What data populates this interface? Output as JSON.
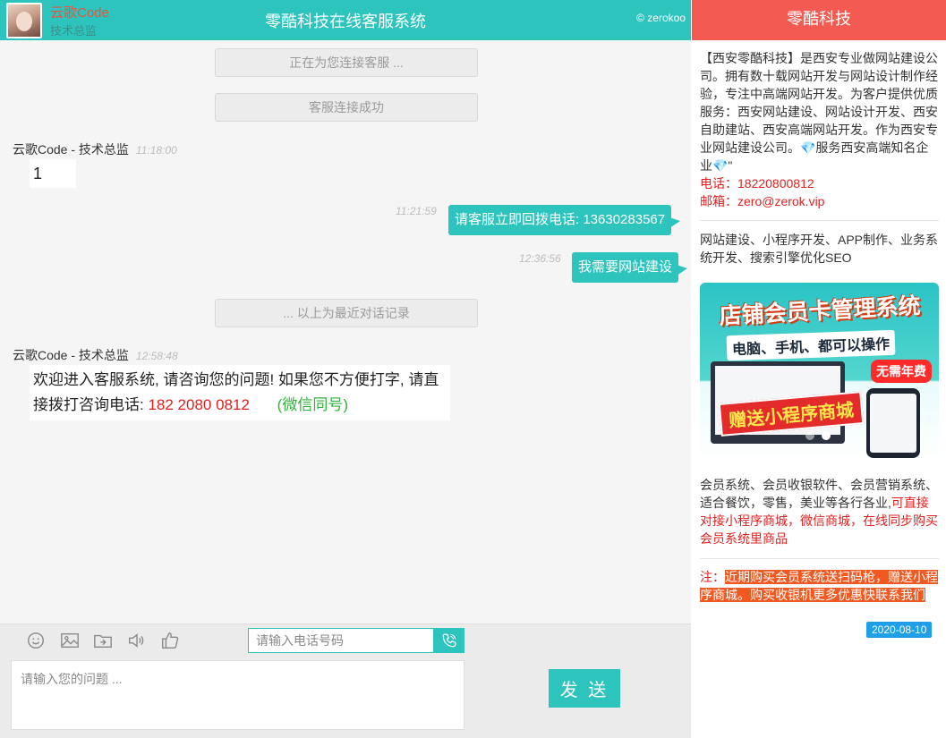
{
  "header": {
    "agent_name": "云歌Code",
    "agent_role": "技术总监",
    "title": "零酷科技在线客服系统",
    "brand": "© zerokoo"
  },
  "system_messages": {
    "connecting": "正在为您连接客服 ...",
    "connected": "客服连接成功",
    "history": "... 以上为最近对话记录"
  },
  "messages": [
    {
      "from": "云歌Code - 技术总监",
      "time": "11:18:00",
      "text": "1"
    },
    {
      "time": "11:21:59",
      "text": "请客服立即回拨电话: 13630283567"
    },
    {
      "time": "12:36:56",
      "text": "我需要网站建设"
    },
    {
      "from": "云歌Code - 技术总监",
      "time": "12:58:48",
      "text_part1": "欢迎进入客服系统, 请咨询您的问题! 如果您不方便打字, 请直接拨打咨询电话:",
      "phone": "182 2080 0812",
      "wechat": "(微信同号)"
    }
  ],
  "toolbar": {
    "icons": [
      "smile-icon",
      "image-icon",
      "file-upload-icon",
      "volume-icon",
      "thumbs-up-icon"
    ],
    "phone_placeholder": "请输入电话号码"
  },
  "composer": {
    "placeholder": "请输入您的问题 ...",
    "send_label": "发 送"
  },
  "side": {
    "title": "零酷科技",
    "intro": "【西安零酷科技】是西安专业做网站建设公司。拥有数十载网站开发与网站设计制作经验，专注中高端网站开发。为客户提供优质服务：西安网站建设、网站设计开发、西安自助建站、西安高端网站开发。作为西安专业网站建设公司。💎服务西安高端知名企业💎\"",
    "phone": "电话：18220800812",
    "email": "邮箱：zero@zerok.vip",
    "services": "网站建设、小程序开发、APP制作、业务系统开发、搜索引擎优化SEO",
    "banner": {
      "title": "店铺会员卡管理系统",
      "subtitle": "电脑、手机、都可以操作",
      "badge": "无需年费",
      "ribbon": "赠送小程序商城"
    },
    "product_desc": "会员系统、会员收银软件、会员营销系统、适合餐饮，零售，美业等各行各业,",
    "product_highlight": "可直接对接小程序商城，微信商城，在线同步购买会员系统里商品",
    "note_label": "注：",
    "note_text": "近期购买会员系统送扫码枪，赠送小程序商城。购买收银机更多优惠快联系我们",
    "date": "2020-08-10"
  }
}
